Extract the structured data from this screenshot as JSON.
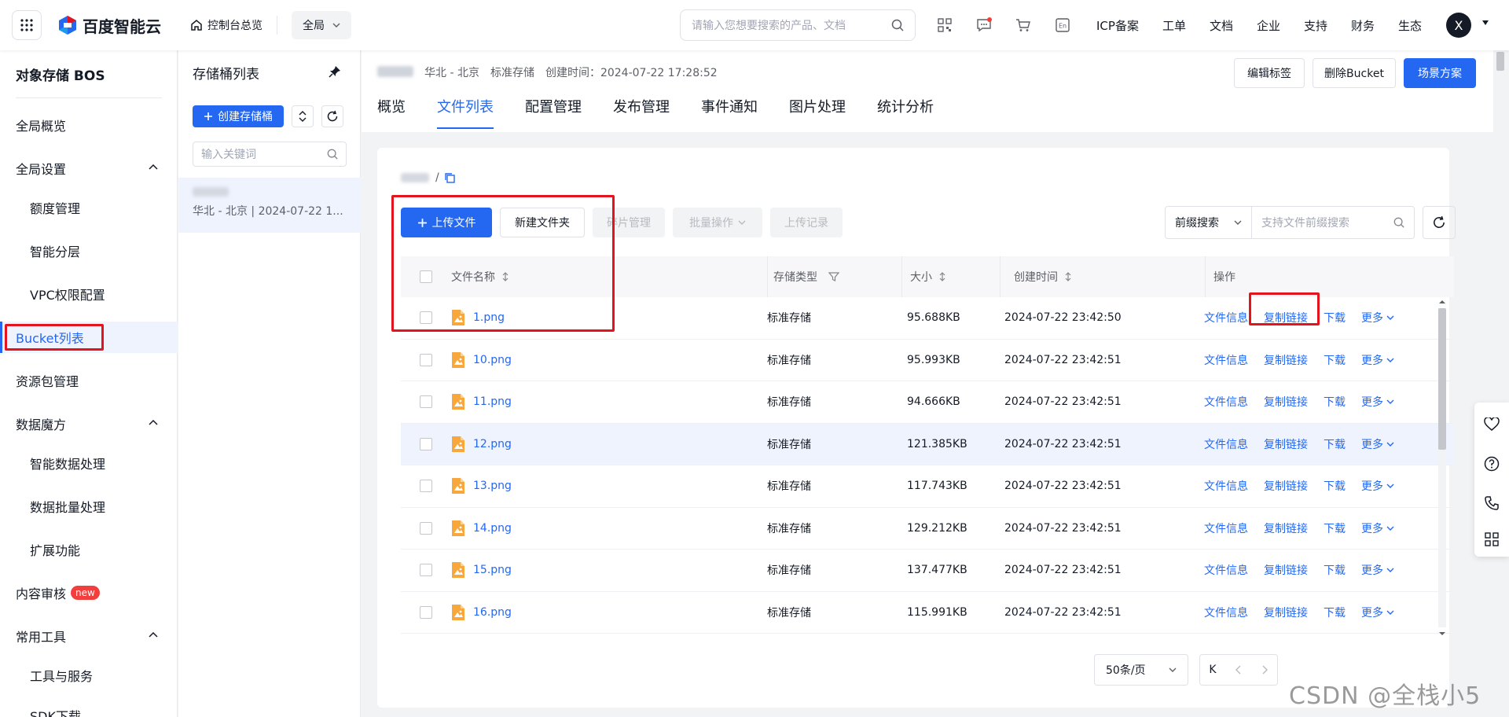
{
  "topbar": {
    "brand": "百度智能云",
    "home_link": "控制台总览",
    "region": "全局",
    "search_placeholder": "请输入您想要搜索的产品、文档",
    "links": [
      "ICP备案",
      "工单",
      "文档",
      "企业",
      "支持",
      "财务",
      "生态"
    ],
    "avatar_letter": "X",
    "icons": [
      "qrcode-icon",
      "message-icon",
      "cart-icon",
      "language-icon"
    ]
  },
  "sidebar": {
    "title": "对象存储 BOS",
    "items": [
      {
        "label": "全局概览",
        "level": 0
      },
      {
        "label": "全局设置",
        "level": 0,
        "expandable": true
      },
      {
        "label": "额度管理",
        "level": 1
      },
      {
        "label": "智能分层",
        "level": 1
      },
      {
        "label": "VPC权限配置",
        "level": 1
      },
      {
        "label": "Bucket列表",
        "level": 0,
        "active": true
      },
      {
        "label": "资源包管理",
        "level": 0
      },
      {
        "label": "数据魔方",
        "level": 0,
        "expandable": true
      },
      {
        "label": "智能数据处理",
        "level": 1
      },
      {
        "label": "数据批量处理",
        "level": 1
      },
      {
        "label": "扩展功能",
        "level": 1
      },
      {
        "label": "内容审核",
        "level": 0,
        "badge": "new"
      },
      {
        "label": "常用工具",
        "level": 0,
        "expandable": true
      },
      {
        "label": "工具与服务",
        "level": 1
      },
      {
        "label": "SDK下载",
        "level": 1
      }
    ]
  },
  "bucket_panel": {
    "title": "存储桶列表",
    "create_label": "创建存储桶",
    "search_placeholder": "输入关键词",
    "selected_meta": "华北 - 北京 | 2024-07-22 1..."
  },
  "header": {
    "region": "华北 - 北京",
    "storage": "标准存储",
    "created": "创建时间：2024-07-22 17:28:52",
    "buttons": {
      "edit_tags": "编辑标签",
      "delete_bucket": "删除Bucket",
      "scenario": "场景方案"
    },
    "tabs": [
      "概览",
      "文件列表",
      "配置管理",
      "发布管理",
      "事件通知",
      "图片处理",
      "统计分析"
    ],
    "active_tab": 1
  },
  "filelist": {
    "crumb_sep": "/",
    "toolbar": {
      "upload": "上传文件",
      "new_folder": "新建文件夹",
      "fragments": "碎片管理",
      "batch": "批量操作",
      "upload_log": "上传记录"
    },
    "prefix_select": "前缀搜索",
    "prefix_placeholder": "支持文件前缀搜索",
    "columns": {
      "name": "文件名称",
      "type": "存储类型",
      "size": "大小",
      "time": "创建时间",
      "ops": "操作"
    },
    "ops": {
      "info": "文件信息",
      "copy": "复制链接",
      "download": "下载",
      "more": "更多"
    },
    "rows": [
      {
        "name": "1.png",
        "type": "标准存储",
        "size": "95.688KB",
        "time": "2024-07-22 23:42:50"
      },
      {
        "name": "10.png",
        "type": "标准存储",
        "size": "95.993KB",
        "time": "2024-07-22 23:42:51"
      },
      {
        "name": "11.png",
        "type": "标准存储",
        "size": "94.666KB",
        "time": "2024-07-22 23:42:51"
      },
      {
        "name": "12.png",
        "type": "标准存储",
        "size": "121.385KB",
        "time": "2024-07-22 23:42:51",
        "hover": true
      },
      {
        "name": "13.png",
        "type": "标准存储",
        "size": "117.743KB",
        "time": "2024-07-22 23:42:51"
      },
      {
        "name": "14.png",
        "type": "标准存储",
        "size": "129.212KB",
        "time": "2024-07-22 23:42:51"
      },
      {
        "name": "15.png",
        "type": "标准存储",
        "size": "137.477KB",
        "time": "2024-07-22 23:42:51"
      },
      {
        "name": "16.png",
        "type": "标准存储",
        "size": "115.991KB",
        "time": "2024-07-22 23:42:51"
      }
    ],
    "page_size": "50条/页",
    "pager_first": "K"
  },
  "watermark": "CSDN @全栈小5",
  "colors": {
    "primary": "#2468f2",
    "annotation": "#e3141d",
    "file_icon": "#f7a73b"
  }
}
